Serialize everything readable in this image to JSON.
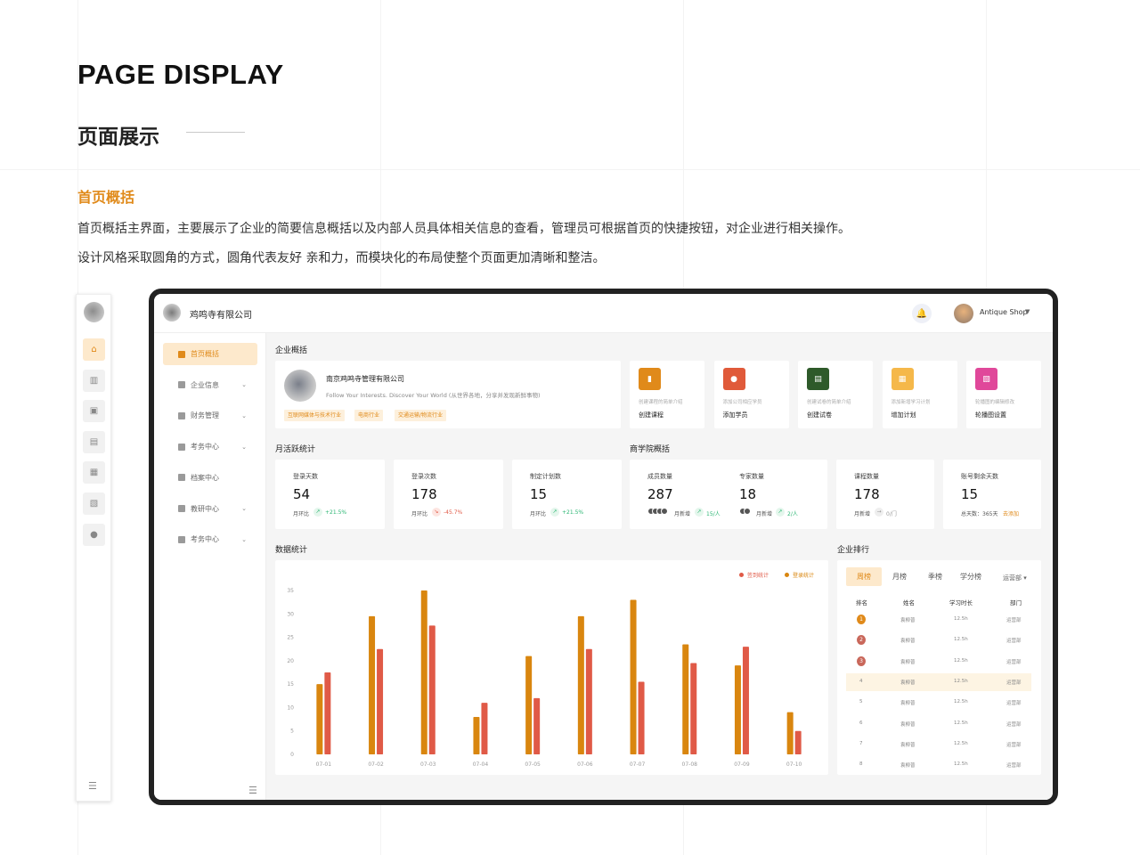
{
  "header": {
    "title": "PAGE DISPLAY",
    "subtitle": "页面展示",
    "section_title": "首页概括",
    "desc1": "首页概括主界面，主要展示了企业的简要信息概括以及内部人员具体相关信息的查看，管理员可根据首页的快捷按钮，对企业进行相关操作。",
    "desc2": "设计风格采取圆角的方式，圆角代表友好 亲和力，而模块化的布局使整个页面更加清晰和整洁。"
  },
  "app": {
    "company": "鸡鸣寺有限公司",
    "user": "Antique Shop",
    "sidebar": [
      {
        "label": "首页概括",
        "active": true
      },
      {
        "label": "企业信息",
        "caret": true
      },
      {
        "label": "财务管理",
        "caret": true
      },
      {
        "label": "考务中心",
        "caret": true
      },
      {
        "label": "档案中心",
        "caret": false
      },
      {
        "label": "教研中心",
        "caret": true
      },
      {
        "label": "考务中心",
        "caret": true
      }
    ]
  },
  "overview": {
    "title": "企业概括",
    "company_name": "南京鸡鸣寺管理有限公司",
    "slogan": "Follow Your Interests. Discover Your World (从世界各地，分享并发现新鲜事物)",
    "tags": [
      "互联网媒体与技术行业",
      "电商行业",
      "交通运输/物流行业"
    ]
  },
  "quick_actions": [
    {
      "hint": "创建课程的简单介绍",
      "label": "创建课程",
      "color": "#e08a1a",
      "icon": "book-icon"
    },
    {
      "hint": "添加公司相应学员",
      "label": "添加学员",
      "color": "#e05a3a",
      "icon": "user-icon"
    },
    {
      "hint": "创建试卷的简单介绍",
      "label": "创建试卷",
      "color": "#2e5a2a",
      "icon": "paper-icon"
    },
    {
      "hint": "添加新增学习计划",
      "label": "增加计划",
      "color": "#f5b84a",
      "icon": "plan-icon"
    },
    {
      "hint": "轮播图的编辑修改",
      "label": "轮播图设置",
      "color": "#e0489a",
      "icon": "image-icon"
    }
  ],
  "monthly": {
    "title": "月活跃统计",
    "items": [
      {
        "label": "登录天数",
        "value": "54",
        "mo": "月环比",
        "change": "+21.5%",
        "dir": "up"
      },
      {
        "label": "登录次数",
        "value": "178",
        "mo": "月环比",
        "change": "-45.7%",
        "dir": "down"
      },
      {
        "label": "制定计划数",
        "value": "15",
        "mo": "月环比",
        "change": "+21.5%",
        "dir": "up"
      }
    ]
  },
  "academy": {
    "title": "商学院概括",
    "members": {
      "label": "成员数量",
      "value": "287",
      "mo": "月新增",
      "change": "15/人"
    },
    "experts": {
      "label": "专家数量",
      "value": "18",
      "mo": "月新增",
      "change": "2/人"
    },
    "courses": {
      "label": "课程数量",
      "value": "178",
      "mo": "月新增",
      "change": "0/门"
    },
    "days": {
      "label": "账号剩余天数",
      "value": "15",
      "total": "总天数：365天",
      "add": "去添加"
    }
  },
  "stats_title": "数据统计",
  "chart_data": {
    "type": "bar",
    "categories": [
      "07-01",
      "07-02",
      "07-03",
      "07-04",
      "07-05",
      "07-06",
      "07-07",
      "07-08",
      "07-09",
      "07-10"
    ],
    "series": [
      {
        "name": "签到统计",
        "values": [
          15,
          29.5,
          35,
          8,
          21,
          29.5,
          33,
          23.5,
          19,
          9
        ],
        "color": "#d9860f"
      },
      {
        "name": "登录统计",
        "values": [
          17.5,
          22.5,
          27.5,
          11,
          12,
          22.5,
          15.5,
          19.5,
          23,
          5
        ],
        "color": "#e05a47"
      }
    ],
    "ylim": [
      0,
      35
    ],
    "yticks": [
      0,
      5,
      10,
      15,
      20,
      25,
      30,
      35
    ],
    "legend": "top-right",
    "grid": false
  },
  "ranking": {
    "title": "企业排行",
    "tabs": [
      "周榜",
      "月榜",
      "季榜",
      "学分榜"
    ],
    "dept_filter": "运营部",
    "headers": [
      "排名",
      "姓名",
      "学习时长",
      "部门"
    ],
    "rows": [
      {
        "rank": "1",
        "name": "袁柳普",
        "time": "12.5h",
        "dept": "运营部"
      },
      {
        "rank": "2",
        "name": "袁柳普",
        "time": "12.5h",
        "dept": "运营部"
      },
      {
        "rank": "3",
        "name": "袁柳普",
        "time": "12.5h",
        "dept": "运营部"
      },
      {
        "rank": "4",
        "name": "袁柳普",
        "time": "12.5h",
        "dept": "运营部"
      },
      {
        "rank": "5",
        "name": "袁柳普",
        "time": "12.5h",
        "dept": "运营部"
      },
      {
        "rank": "6",
        "name": "袁柳普",
        "time": "12.5h",
        "dept": "运营部"
      },
      {
        "rank": "7",
        "name": "袁柳普",
        "time": "12.5h",
        "dept": "运营部"
      },
      {
        "rank": "8",
        "name": "袁柳普",
        "time": "12.5h",
        "dept": "运营部"
      }
    ]
  }
}
